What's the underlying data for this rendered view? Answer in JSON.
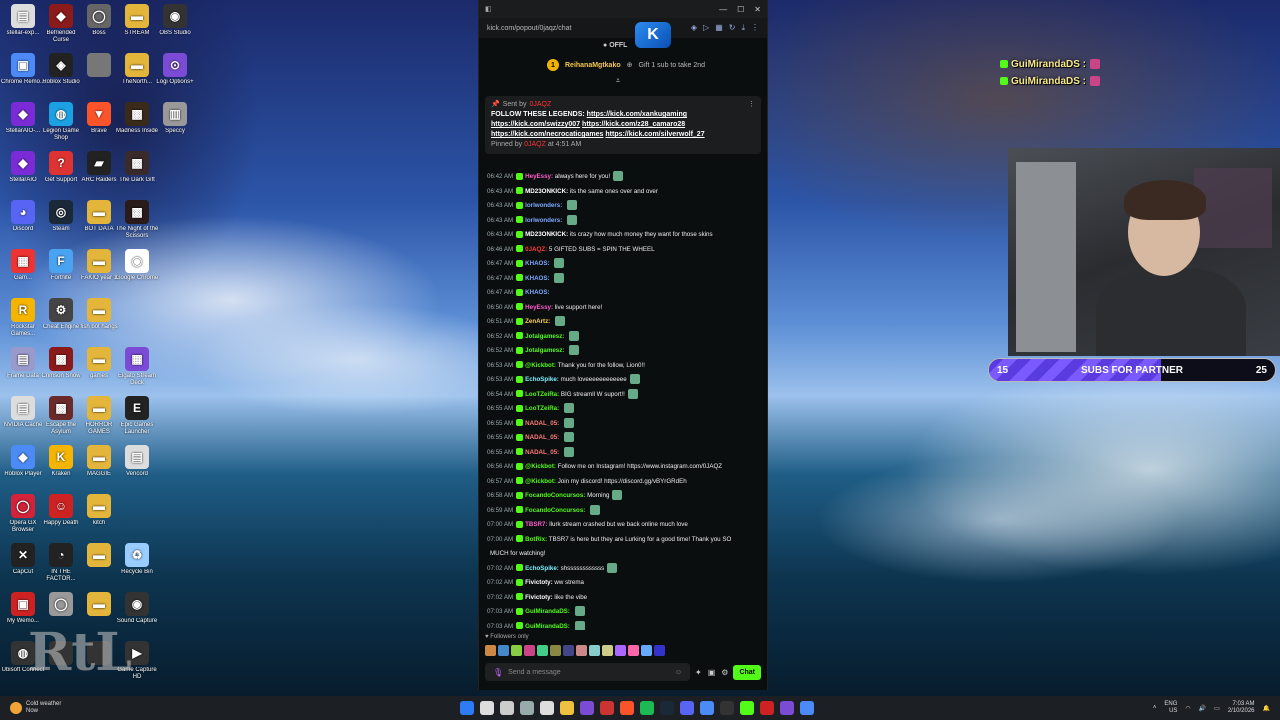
{
  "desktop_icons": [
    {
      "label": "stellar-exp...",
      "color": "#ddd",
      "glyph": "▤",
      "col": 0,
      "row": 0
    },
    {
      "label": "Befriended Curse",
      "color": "#8b1a1a",
      "glyph": "◆",
      "col": 1,
      "row": 0
    },
    {
      "label": "Boss",
      "color": "#666",
      "glyph": "◯",
      "col": 2,
      "row": 0
    },
    {
      "label": "STREAM",
      "color": "#e3b53a",
      "glyph": "▬",
      "col": 3,
      "row": 0
    },
    {
      "label": "OBS Studio",
      "color": "#333",
      "glyph": "◉",
      "col": 4,
      "row": 0
    },
    {
      "label": "Chrome Remo...",
      "color": "#4c8bf5",
      "glyph": "▣",
      "col": 0,
      "row": 1
    },
    {
      "label": "Roblox Studio",
      "color": "#222",
      "glyph": "◈",
      "col": 1,
      "row": 1
    },
    {
      "label": "",
      "color": "#777",
      "glyph": "",
      "col": 2,
      "row": 1
    },
    {
      "label": "TheNorth...",
      "color": "#e3b53a",
      "glyph": "▬",
      "col": 3,
      "row": 1
    },
    {
      "label": "Logi Options+",
      "color": "#7b4bd6",
      "glyph": "⊙",
      "col": 4,
      "row": 1
    },
    {
      "label": "StellarAIO-...",
      "color": "#7b2bd6",
      "glyph": "◆",
      "col": 0,
      "row": 2
    },
    {
      "label": "Legion Game Shop",
      "color": "#1ba1e2",
      "glyph": "◍",
      "col": 1,
      "row": 2
    },
    {
      "label": "Brave",
      "color": "#fb542b",
      "glyph": "▼",
      "col": 2,
      "row": 2
    },
    {
      "label": "Madness Inside",
      "color": "#3a2a1a",
      "glyph": "▩",
      "col": 3,
      "row": 2
    },
    {
      "label": "Speccy",
      "color": "#999",
      "glyph": "▥",
      "col": 4,
      "row": 2
    },
    {
      "label": "StellarAIO",
      "color": "#7b2bd6",
      "glyph": "◆",
      "col": 0,
      "row": 3
    },
    {
      "label": "Get Support",
      "color": "#d33",
      "glyph": "?",
      "col": 1,
      "row": 3
    },
    {
      "label": "ARC Raiders",
      "color": "#222",
      "glyph": "▰",
      "col": 2,
      "row": 3
    },
    {
      "label": "The Dark Gift",
      "color": "#3a2a2a",
      "glyph": "▩",
      "col": 3,
      "row": 3
    },
    {
      "label": "Discord",
      "color": "#5865f2",
      "glyph": "◕",
      "col": 0,
      "row": 4
    },
    {
      "label": "Steam",
      "color": "#1b2838",
      "glyph": "◎",
      "col": 1,
      "row": 4
    },
    {
      "label": "BOT DATA",
      "color": "#e3b53a",
      "glyph": "▬",
      "col": 2,
      "row": 4
    },
    {
      "label": "The Night of the Scissors",
      "color": "#2a1a1a",
      "glyph": "▩",
      "col": 3,
      "row": 4
    },
    {
      "label": "Gam...",
      "color": "#e33",
      "glyph": "▦",
      "col": 0,
      "row": 5
    },
    {
      "label": "Fortnite",
      "color": "#4aa3f0",
      "glyph": "F",
      "col": 1,
      "row": 5
    },
    {
      "label": "FAKIO year 1",
      "color": "#e3b53a",
      "glyph": "▬",
      "col": 2,
      "row": 5
    },
    {
      "label": "Google Chrome",
      "color": "#fff",
      "glyph": "◉",
      "col": 3,
      "row": 5
    },
    {
      "label": "Rockstar Games...",
      "color": "#f4b400",
      "glyph": "R",
      "col": 0,
      "row": 6
    },
    {
      "label": "Cheat Engine",
      "color": "#444",
      "glyph": "⚙",
      "col": 1,
      "row": 6
    },
    {
      "label": "fish bot hangs",
      "color": "#e3b53a",
      "glyph": "▬",
      "col": 2,
      "row": 6
    },
    {
      "label": "Frame Data",
      "color": "#99c",
      "glyph": "▤",
      "col": 0,
      "row": 7
    },
    {
      "label": "Crimson Snow",
      "color": "#8a1a1a",
      "glyph": "▩",
      "col": 1,
      "row": 7
    },
    {
      "label": "games",
      "color": "#e3b53a",
      "glyph": "▬",
      "col": 2,
      "row": 7
    },
    {
      "label": "Elgato Stream Deck",
      "color": "#7b4bd6",
      "glyph": "▦",
      "col": 3,
      "row": 7
    },
    {
      "label": "NVIDIA Cache",
      "color": "#ddd",
      "glyph": "▤",
      "col": 0,
      "row": 8
    },
    {
      "label": "Escape the Asylum",
      "color": "#6a2a2a",
      "glyph": "▩",
      "col": 1,
      "row": 8
    },
    {
      "label": "HORROR GAMES",
      "color": "#e3b53a",
      "glyph": "▬",
      "col": 2,
      "row": 8
    },
    {
      "label": "Epic Games Launcher",
      "color": "#222",
      "glyph": "E",
      "col": 3,
      "row": 8
    },
    {
      "label": "Roblox Player",
      "color": "#4c8bf5",
      "glyph": "◆",
      "col": 0,
      "row": 9
    },
    {
      "label": "Kraken",
      "color": "#f4b400",
      "glyph": "K",
      "col": 1,
      "row": 9
    },
    {
      "label": "MAGGIE",
      "color": "#e3b53a",
      "glyph": "▬",
      "col": 2,
      "row": 9
    },
    {
      "label": "Vencord",
      "color": "#ddd",
      "glyph": "▤",
      "col": 3,
      "row": 9
    },
    {
      "label": "Opera GX Browser",
      "color": "#d3223a",
      "glyph": "◯",
      "col": 0,
      "row": 10
    },
    {
      "label": "Happy Death",
      "color": "#c22",
      "glyph": "☺",
      "col": 1,
      "row": 10
    },
    {
      "label": "kitch",
      "color": "#e3b53a",
      "glyph": "▬",
      "col": 2,
      "row": 10
    },
    {
      "label": "CapCut",
      "color": "#222",
      "glyph": "✕",
      "col": 0,
      "row": 11
    },
    {
      "label": "IN THE FACTOR...",
      "color": "#222",
      "glyph": "◔",
      "col": 1,
      "row": 11
    },
    {
      "label": "",
      "color": "#e3b53a",
      "glyph": "▬",
      "col": 2,
      "row": 11
    },
    {
      "label": "Recycle Bin",
      "color": "#9cf",
      "glyph": "♻",
      "col": 3,
      "row": 11
    },
    {
      "label": "My Wemo...",
      "color": "#c22",
      "glyph": "▣",
      "col": 0,
      "row": 12
    },
    {
      "label": "",
      "color": "#999",
      "glyph": "◯",
      "col": 1,
      "row": 12
    },
    {
      "label": "",
      "color": "#e3b53a",
      "glyph": "▬",
      "col": 2,
      "row": 12
    },
    {
      "label": "Sound Capture",
      "color": "#333",
      "glyph": "◉",
      "col": 3,
      "row": 12
    },
    {
      "label": "Ubisoft Connect",
      "color": "#333",
      "glyph": "◍",
      "col": 0,
      "row": 13
    },
    {
      "label": "",
      "color": "#333",
      "glyph": "",
      "col": 1,
      "row": 13
    },
    {
      "label": "",
      "color": "#333",
      "glyph": "",
      "col": 2,
      "row": 13
    },
    {
      "label": "Game Capture HD",
      "color": "#333",
      "glyph": "▶",
      "col": 3,
      "row": 13
    }
  ],
  "browser": {
    "url": "kick.com/popout/0jaqz/chat",
    "status": "OFFL",
    "logo_glyph": "K"
  },
  "gift_bar": {
    "user": "ReihanaMgtkako",
    "coin": "1",
    "text": "Gift 1 sub to take 2nd"
  },
  "pinned": {
    "sent_by": "Sent by",
    "sent_name": "0JAQZ",
    "body_intro": "FOLLOW THESE LEGENDS: ",
    "links": [
      "https://kick.com/xankugaming",
      "https://kick.com/swizzy007",
      "https://kick.com/z28_camaro28",
      "https://kick.com/necrocaticgames",
      "https://kick.com/silverwolf_27"
    ],
    "pinned_by": "Pinned by",
    "pinned_name": "0JAQZ",
    "pinned_time": "at 4:51 AM"
  },
  "messages": [
    {
      "t": "06:42 AM",
      "n": "HeyEssy:",
      "c": "#ff5ccf",
      "m": "always here for you!",
      "e": true
    },
    {
      "t": "06:43 AM",
      "n": "MD23ONKICK:",
      "c": "#ffffff",
      "m": "its the same ones over and over",
      "e": false
    },
    {
      "t": "06:43 AM",
      "n": "lorlwonders:",
      "c": "#7da8ff",
      "m": "",
      "e": true
    },
    {
      "t": "06:43 AM",
      "n": "lorlwonders:",
      "c": "#7da8ff",
      "m": "",
      "e": true
    },
    {
      "t": "06:43 AM",
      "n": "MD23ONKICK:",
      "c": "#ffffff",
      "m": "its crazy how much money they want for those skins",
      "e": false
    },
    {
      "t": "06:46 AM",
      "n": "0JAQZ:",
      "c": "#ff3b3b",
      "m": "5 GIFTED SUBS = SPIN THE WHEEL",
      "e": false
    },
    {
      "t": "06:47 AM",
      "n": "KHAOS:",
      "c": "#7da8ff",
      "m": "",
      "e": true
    },
    {
      "t": "06:47 AM",
      "n": "KHAOS:",
      "c": "#7da8ff",
      "m": "",
      "e": true
    },
    {
      "t": "06:47 AM",
      "n": "KHAOS:",
      "c": "#7da8ff",
      "m": "",
      "e": false
    },
    {
      "t": "06:50 AM",
      "n": "HeyEssy:",
      "c": "#ff5ccf",
      "m": "live support here!",
      "e": false
    },
    {
      "t": "06:51 AM",
      "n": "ZenArtz:",
      "c": "#ffd24a",
      "m": "",
      "e": true
    },
    {
      "t": "06:52 AM",
      "n": "Jotalgamesz:",
      "c": "#53fc18",
      "m": "",
      "e": true
    },
    {
      "t": "06:52 AM",
      "n": "Jotalgamesz:",
      "c": "#53fc18",
      "m": "",
      "e": true
    },
    {
      "t": "06:53 AM",
      "n": "@Kickbot:",
      "c": "#53fc18",
      "m": "Thank you for the follow, Lion0!!",
      "e": false
    },
    {
      "t": "06:53 AM",
      "n": "EchoSpike:",
      "c": "#7df0ff",
      "m": "much loveeeeeeeeeeee",
      "e": true
    },
    {
      "t": "06:54 AM",
      "n": "LooTZeiRa:",
      "c": "#53fc18",
      "m": "BIG streamll W suport!!",
      "e": true
    },
    {
      "t": "06:55 AM",
      "n": "LooTZeiRa:",
      "c": "#53fc18",
      "m": "",
      "e": true
    },
    {
      "t": "06:55 AM",
      "n": "NADAL_05:",
      "c": "#ff7a7a",
      "m": "",
      "e": true
    },
    {
      "t": "06:55 AM",
      "n": "NADAL_05:",
      "c": "#ff7a7a",
      "m": "",
      "e": true
    },
    {
      "t": "06:55 AM",
      "n": "NADAL_05:",
      "c": "#ff7a7a",
      "m": "",
      "e": true
    },
    {
      "t": "06:56 AM",
      "n": "@Kickbot:",
      "c": "#53fc18",
      "m": "Follow me on Instagram! https://www.instagram.com/0JAQZ",
      "e": false
    },
    {
      "t": "06:57 AM",
      "n": "@Kickbot:",
      "c": "#53fc18",
      "m": "Join my discord! https://discord.gg/vBYrGRdEh",
      "e": false
    },
    {
      "t": "06:58 AM",
      "n": "FocandoConcursos:",
      "c": "#53fc18",
      "m": "Morning",
      "e": true
    },
    {
      "t": "06:59 AM",
      "n": "FocandoConcursos:",
      "c": "#53fc18",
      "m": "",
      "e": true
    },
    {
      "t": "07:00 AM",
      "n": "TBSR7:",
      "c": "#ff5ccf",
      "m": "llurk stream crashed but we back online much love",
      "e": false
    },
    {
      "t": "07:00 AM",
      "n": "BotRix:",
      "c": "#53fc18",
      "m": "TBSR7 is here but they are Lurking for a good time! Thank you SO",
      "e": false
    },
    {
      "t": "",
      "n": "",
      "c": "#ffffff",
      "m": "MUCH for watching!",
      "e": false
    },
    {
      "t": "07:02 AM",
      "n": "EchoSpike:",
      "c": "#7df0ff",
      "m": "shssssssssssss",
      "e": true
    },
    {
      "t": "07:02 AM",
      "n": "Fivictoty:",
      "c": "#ffffff",
      "m": "ww strema",
      "e": false
    },
    {
      "t": "07:02 AM",
      "n": "Fivictoty:",
      "c": "#ffffff",
      "m": "like the vibe",
      "e": false
    },
    {
      "t": "07:03 AM",
      "n": "GuiMirandaDS:",
      "c": "#53fc18",
      "m": "",
      "e": true
    },
    {
      "t": "07:03 AM",
      "n": "GuiMirandaDS:",
      "c": "#53fc18",
      "m": "",
      "e": true
    }
  ],
  "chat_footer": {
    "followers_only": "Followers only",
    "placeholder": "Send a message",
    "chat_button": "Chat",
    "emote_count": 14
  },
  "overlay_chat": [
    {
      "user": "GuiMirandaDS :"
    },
    {
      "user": "GuiMirandaDS :"
    }
  ],
  "goal": {
    "current": "15",
    "title": "SUBS FOR PARTNER",
    "target": "25",
    "progress": 0.6
  },
  "watermark": "RtL",
  "taskbar": {
    "weather_title": "Cold weather",
    "weather_sub": "Now",
    "lang_1": "ENG",
    "lang_2": "US",
    "time": "7:03 AM",
    "date": "2/10/2026",
    "icons": [
      "#2d7cf6",
      "#ddd",
      "#ccc",
      "#9aa",
      "#ddd",
      "#f0c040",
      "#7b4bd6",
      "#c33",
      "#fb542b",
      "#1db954",
      "#1b2838",
      "#5865f2",
      "#4c8bf5",
      "#333",
      "#53fc18",
      "#c22",
      "#7b4bd6",
      "#4c8bf5"
    ]
  }
}
